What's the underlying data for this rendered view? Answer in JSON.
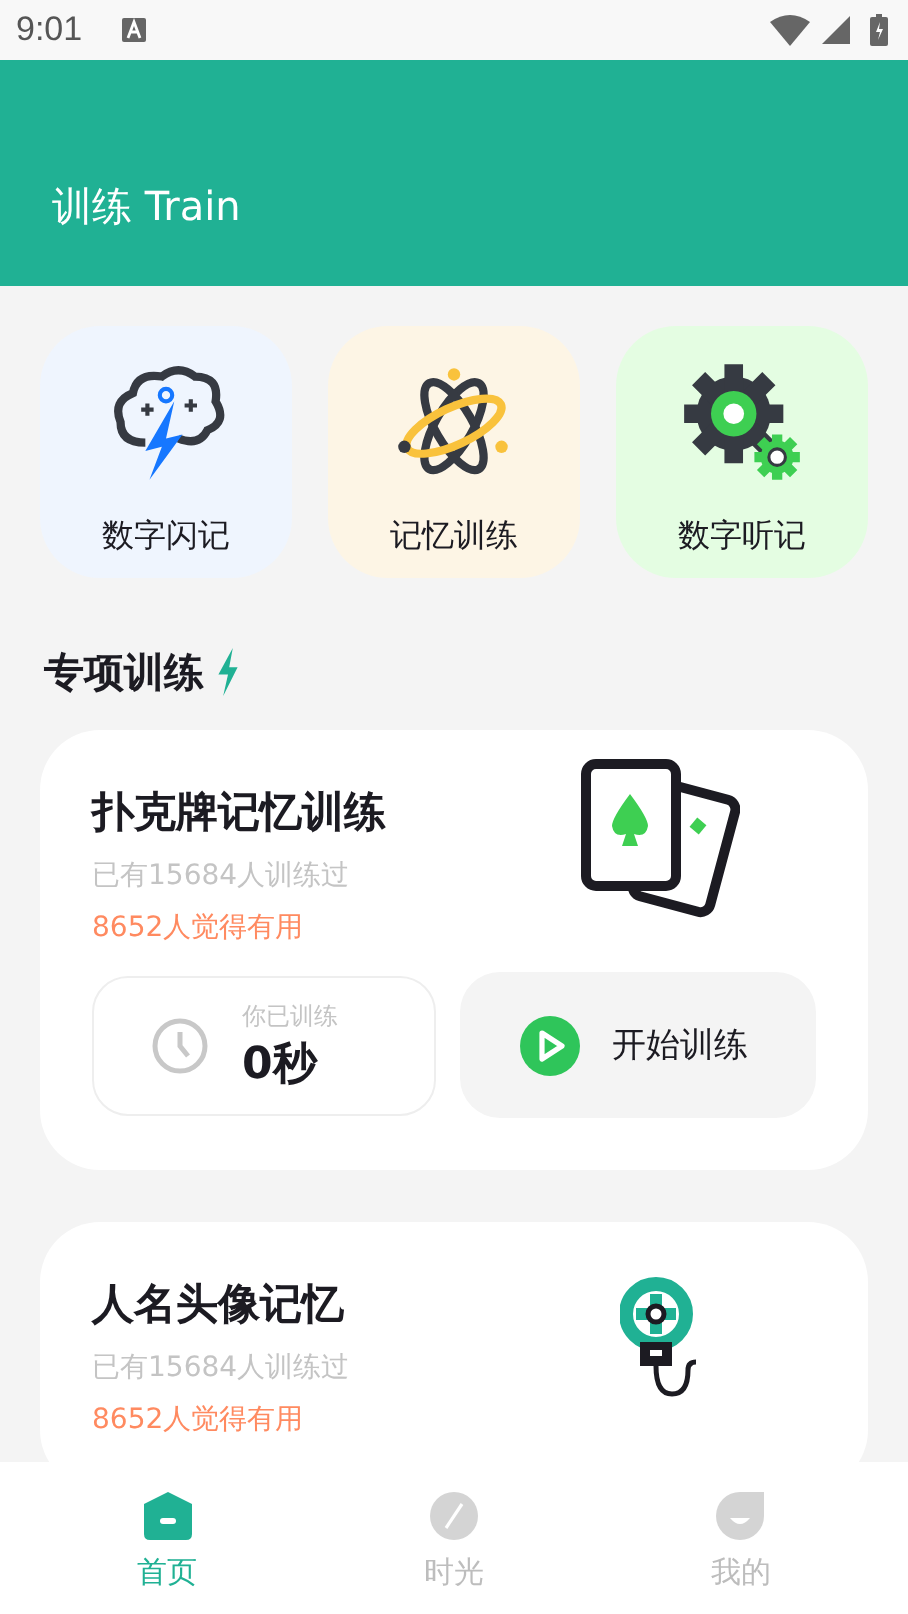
{
  "status_bar": {
    "time": "9:01"
  },
  "header": {
    "title": "训练 Train"
  },
  "features": [
    {
      "label": "数字闪记",
      "kind": "brain",
      "color": "#eff5fe"
    },
    {
      "label": "记忆训练",
      "kind": "atom",
      "color": "#fdf5e5"
    },
    {
      "label": "数字听记",
      "kind": "gears",
      "color": "#e4fde2"
    }
  ],
  "section": {
    "title": "专项训练"
  },
  "courses": [
    {
      "title": "扑克牌记忆训练",
      "kind": "cards",
      "trained": "已有15684人训练过",
      "useful": "8652人觉得有用",
      "progress_label": "你已训练",
      "progress_value": "0秒",
      "start": "开始训练"
    },
    {
      "title": "人名头像记忆",
      "kind": "bulb",
      "trained": "已有15684人训练过",
      "useful": "8652人觉得有用"
    }
  ],
  "tabs": [
    {
      "label": "首页",
      "kind": "home",
      "selected": true
    },
    {
      "label": "时光",
      "kind": "compass",
      "selected": false
    },
    {
      "label": "我的",
      "kind": "face",
      "selected": false
    }
  ]
}
